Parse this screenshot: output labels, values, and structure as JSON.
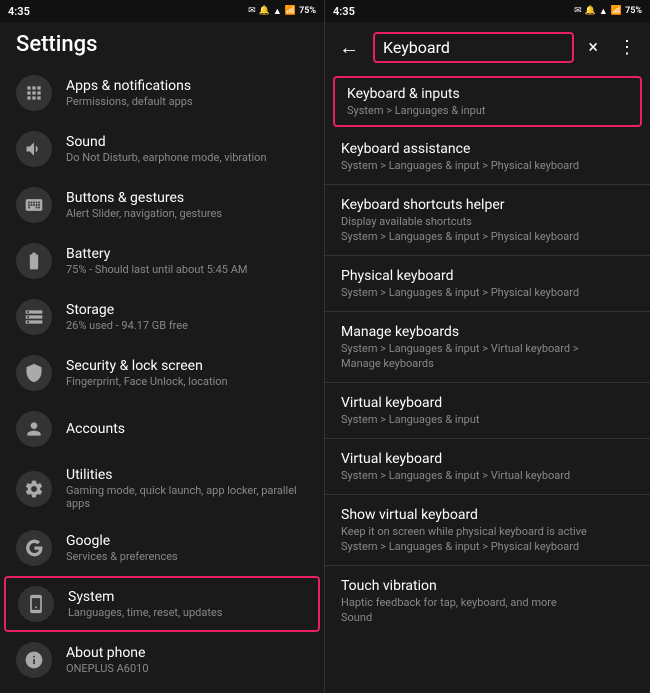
{
  "left": {
    "status": {
      "time": "4:35",
      "battery": "75%"
    },
    "page_title": "Settings",
    "items": [
      {
        "title": "Apps & notifications",
        "sub": "Permissions, default apps",
        "icon": "apps"
      },
      {
        "title": "Sound",
        "sub": "Do Not Disturb, earphone mode, vibration",
        "icon": "sound"
      },
      {
        "title": "Buttons & gestures",
        "sub": "Alert Slider, navigation, gestures",
        "icon": "buttons"
      },
      {
        "title": "Battery",
        "sub": "75% - Should last until about 5:45 AM",
        "icon": "battery"
      },
      {
        "title": "Storage",
        "sub": "26% used - 94.17 GB free",
        "icon": "storage"
      },
      {
        "title": "Security & lock screen",
        "sub": "Fingerprint, Face Unlock, location",
        "icon": "security"
      },
      {
        "title": "Accounts",
        "sub": "",
        "icon": "accounts"
      },
      {
        "title": "Utilities",
        "sub": "Gaming mode, quick launch, app locker, parallel apps",
        "icon": "utilities"
      },
      {
        "title": "Google",
        "sub": "Services & preferences",
        "icon": "google"
      },
      {
        "title": "System",
        "sub": "Languages, time, reset, updates",
        "icon": "system",
        "highlighted": true
      },
      {
        "title": "About phone",
        "sub": "ONEPLUS A6010",
        "icon": "about"
      }
    ]
  },
  "right": {
    "status": {
      "time": "4:35",
      "battery": "75%"
    },
    "header": {
      "search_text": "Keyboard",
      "close_label": "×",
      "more_label": "⋮"
    },
    "results": [
      {
        "title": "Keyboard & inputs",
        "sub": "System > Languages & input",
        "highlighted": true
      },
      {
        "title": "Keyboard assistance",
        "sub": "System > Languages & input > Physical keyboard",
        "highlighted": false
      },
      {
        "title": "Keyboard shortcuts helper",
        "sub2": "Display available shortcuts",
        "sub": "System > Languages & input > Physical keyboard",
        "highlighted": false
      },
      {
        "title": "Physical keyboard",
        "sub": "System > Languages & input > Physical keyboard",
        "highlighted": false
      },
      {
        "title": "Manage keyboards",
        "sub2": "System > Languages & input > Virtual keyboard >",
        "sub": "Manage keyboards",
        "highlighted": false
      },
      {
        "title": "Virtual keyboard",
        "sub": "System > Languages & input",
        "highlighted": false
      },
      {
        "title": "Virtual keyboard",
        "sub": "System > Languages & input > Virtual keyboard",
        "highlighted": false
      },
      {
        "title": "Show virtual keyboard",
        "sub2": "Keep it on screen while physical keyboard is active",
        "sub": "System > Languages & input > Physical keyboard",
        "highlighted": false
      },
      {
        "title": "Touch vibration",
        "sub2": "Haptic feedback for tap, keyboard, and more",
        "sub": "Sound",
        "highlighted": false
      }
    ]
  }
}
